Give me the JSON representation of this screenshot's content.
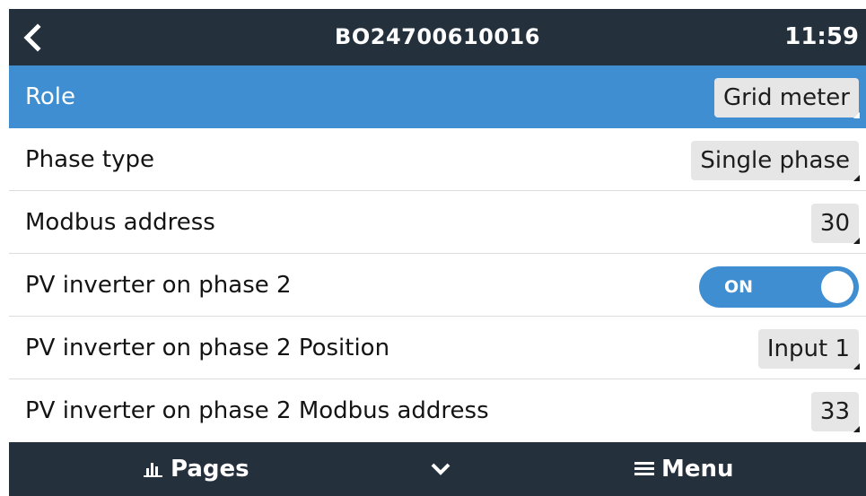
{
  "header": {
    "title": "BO24700610016",
    "time": "11:59"
  },
  "settings": [
    {
      "label": "Role",
      "value": "Grid meter"
    },
    {
      "label": "Phase type",
      "value": "Single phase"
    },
    {
      "label": "Modbus address",
      "value": "30"
    },
    {
      "label": "PV inverter on phase 2",
      "toggle": "ON"
    },
    {
      "label": "PV inverter on phase 2 Position",
      "value": "Input 1"
    },
    {
      "label": "PV inverter on phase 2 Modbus address",
      "value": "33"
    }
  ],
  "footer": {
    "pages_label": "Pages",
    "menu_label": "Menu"
  },
  "colors": {
    "bar_background": "#25303d",
    "highlight": "#3f8ed1",
    "value_box": "#e6e6e6"
  },
  "icons": [
    "back-arrow-icon",
    "bar-chart-icon",
    "chevron-down-icon",
    "hamburger-menu-icon"
  ]
}
